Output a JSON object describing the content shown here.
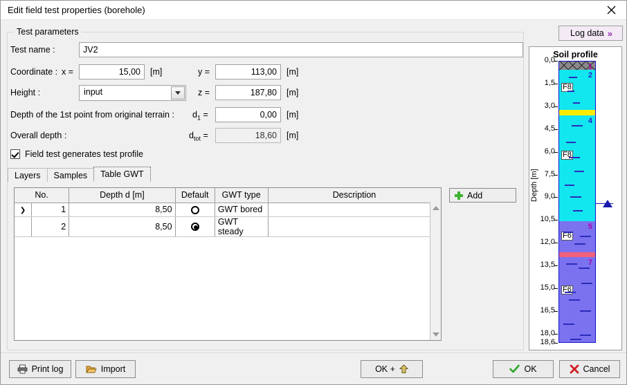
{
  "window": {
    "title": "Edit field test properties (borehole)",
    "close_icon": "close-icon"
  },
  "log_data": {
    "label": "Log data",
    "icon": "double-chevron-right-icon",
    "accent": "#9b2fae"
  },
  "group": {
    "legend": "Test parameters"
  },
  "form": {
    "test_name": {
      "label": "Test name :",
      "value": "JV2"
    },
    "coordinate": {
      "label": "Coordinate :",
      "x_label": "x =",
      "x_value": "15,00",
      "x_unit": "[m]",
      "y_label": "y =",
      "y_value": "113,00",
      "y_unit": "[m]"
    },
    "height": {
      "label": "Height :",
      "combo_value": "input",
      "z_label": "z =",
      "z_value": "187,80",
      "z_unit": "[m]"
    },
    "depth_first_point": {
      "label": "Depth of the 1st point from original terrain :",
      "symbol": "d",
      "symbol_sub": "1",
      "eq": "=",
      "value": "0,00",
      "unit": "[m]"
    },
    "overall_depth": {
      "label": "Overall depth :",
      "symbol": "d",
      "symbol_sub": "tot",
      "eq": "=",
      "value": "18,60",
      "unit": "[m]"
    },
    "generates_profile": {
      "label": "Field test generates test profile",
      "checked": true
    }
  },
  "tabs": [
    {
      "label": "Layers",
      "active": false
    },
    {
      "label": "Samples",
      "active": false
    },
    {
      "label": "Table GWT",
      "active": true
    }
  ],
  "table": {
    "columns": [
      "No.",
      "Depth d [m]",
      "Default",
      "GWT type",
      "Description"
    ],
    "rows": [
      {
        "marker": "❯",
        "no": "1",
        "depth": "8,50",
        "default": "empty",
        "gwt_type": "GWT bored",
        "description": ""
      },
      {
        "marker": "",
        "no": "2",
        "depth": "8,50",
        "default": "selected",
        "gwt_type": "GWT steady",
        "description": ""
      }
    ]
  },
  "add_button": {
    "label": "Add",
    "icon": "plus-icon"
  },
  "soil_profile": {
    "title": "Soil profile",
    "axis_label": "Depth [m]",
    "axis_ticks": [
      "0,0",
      "1,5",
      "3,0",
      "4,5",
      "6,0",
      "7,5",
      "9,0",
      "10,5",
      "12,0",
      "13,5",
      "15,0",
      "16,5",
      "18,0",
      "18,6"
    ],
    "axis_min": 0.0,
    "axis_max": 18.6,
    "layers": [
      {
        "id": "1",
        "name": "",
        "from": 0.0,
        "to": 0.55,
        "color": "#8a8a8a",
        "pattern": "hatch-fill",
        "num_color": "#aa00aa"
      },
      {
        "id": "2",
        "name": "F8",
        "from": 0.55,
        "to": 3.2,
        "color": "#12e6ee",
        "pattern": "solid",
        "num_color": "#2222cc"
      },
      {
        "id": "3",
        "name": "",
        "from": 3.2,
        "to": 3.55,
        "color": "#ffec00",
        "pattern": "solid",
        "num_color": "#2222cc"
      },
      {
        "id": "4",
        "name": "F8",
        "from": 3.55,
        "to": 10.55,
        "color": "#12e6ee",
        "pattern": "solid",
        "num_color": "#2222cc"
      },
      {
        "id": "5",
        "name": "F6",
        "from": 10.55,
        "to": 12.6,
        "color": "#7b72ef",
        "pattern": "solid",
        "num_color": "#aa00aa"
      },
      {
        "id": "6",
        "name": "",
        "from": 12.6,
        "to": 12.9,
        "color": "#f2607a",
        "pattern": "solid",
        "num_color": "#aa00aa"
      },
      {
        "id": "7",
        "name": "F6",
        "from": 12.9,
        "to": 18.6,
        "color": "#7b72ef",
        "pattern": "solid",
        "num_color": "#aa00aa"
      }
    ],
    "gwt_marker": {
      "depth": 9.4,
      "color": "#1a1ab0"
    }
  },
  "footer": {
    "print_log": {
      "label": "Print log",
      "icon": "printer-icon"
    },
    "import": {
      "label": "Import",
      "icon": "folder-open-icon"
    },
    "ok_plus": {
      "label": "OK +",
      "icon": "up-arrow-icon"
    },
    "ok": {
      "label": "OK",
      "icon": "check-icon"
    },
    "cancel": {
      "label": "Cancel",
      "icon": "cross-icon"
    }
  }
}
